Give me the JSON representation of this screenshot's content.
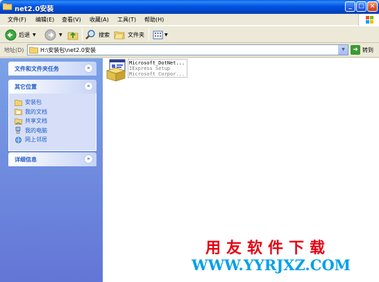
{
  "window": {
    "title": "net2.0安装",
    "min_glyph": "_",
    "max_glyph": "□",
    "close_glyph": "×"
  },
  "menu": {
    "items": [
      "文件(F)",
      "编辑(E)",
      "查看(V)",
      "收藏(A)",
      "工具(T)",
      "帮助(H)"
    ]
  },
  "toolbar": {
    "back_label": "后退",
    "search_label": "搜索",
    "folders_label": "文件夹"
  },
  "address": {
    "label": "地址(D)",
    "value": "H:\\安装包\\net2.0安装",
    "go_label": "转到"
  },
  "task_pane": {
    "file_tasks_title": "文件和文件夹任务",
    "other_places_title": "其它位置",
    "other_places": [
      "安装包",
      "我的文档",
      "共享文档",
      "我的电脑",
      "网上邻居"
    ],
    "details_title": "详细信息"
  },
  "files": [
    {
      "name": "Microsoft_DotNet...",
      "desc1": "IExpress Setup",
      "desc2": "Microsoft Corpor..."
    }
  ],
  "watermark": {
    "brand": "用友软件下载",
    "url": "WWW.YYRJXZ.COM"
  },
  "colors": {
    "title_blue": "#0054E3",
    "task_pane_blue": "#7BA2E7",
    "link_blue": "#215DC6",
    "watermark_red": "#E60012",
    "watermark_cyan": "#00A0E9"
  }
}
